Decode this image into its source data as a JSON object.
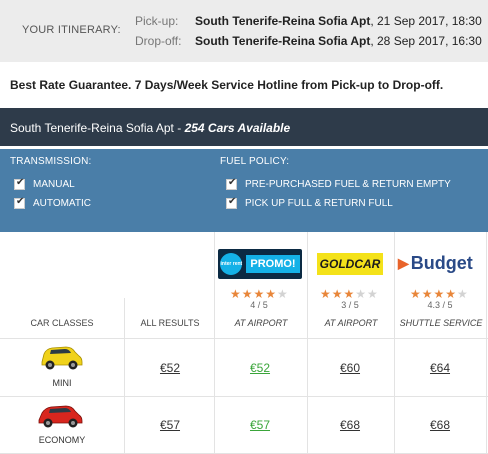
{
  "itinerary": {
    "label": "YOUR ITINERARY:",
    "pickup_key": "Pick-up:",
    "pickup_loc": "South Tenerife-Reina Sofia Apt",
    "pickup_date": ", 21 Sep 2017, 18:30",
    "dropoff_key": "Drop-off:",
    "dropoff_loc": "South Tenerife-Reina Sofia Apt",
    "dropoff_date": ", 28 Sep 2017, 16:30"
  },
  "guarantee": "Best Rate Guarantee. 7 Days/Week Service Hotline from Pick-up to Drop-off.",
  "results_bar": {
    "location": "South Tenerife-Reina Sofia Apt",
    "separator": " - ",
    "count": "254 Cars Available"
  },
  "filters": {
    "transmission_title": "TRANSMISSION:",
    "transmission_options": [
      "MANUAL",
      "AUTOMATIC"
    ],
    "fuel_title": "FUEL POLICY:",
    "fuel_options": [
      "PRE-PURCHASED FUEL & RETURN EMPTY",
      "PICK UP FULL & RETURN FULL"
    ]
  },
  "suppliers": [
    {
      "name": "interrent",
      "logo_text": "PROMO!",
      "logo_small": "inter rent",
      "stars": 4,
      "rating": "4 / 5",
      "location": "AT AIRPORT",
      "color": "#0b2a43"
    },
    {
      "name": "goldcar",
      "logo_text": "GOLDCAR",
      "stars": 3,
      "rating": "3 / 5",
      "location": "AT AIRPORT",
      "color": "#f4e21a"
    },
    {
      "name": "budget",
      "logo_text": "Budget",
      "stars": 4,
      "rating": "4.3 / 5",
      "location": "SHUTTLE SERVICE",
      "color": "#2a4a87"
    }
  ],
  "table": {
    "col_car_classes": "CAR CLASSES",
    "col_all_results": "ALL RESULTS",
    "rows": [
      {
        "class": "MINI",
        "car_color": "#f0d21a",
        "prices": [
          "€52",
          "€52",
          "€60",
          "€64"
        ]
      },
      {
        "class": "ECONOMY",
        "car_color": "#d8261e",
        "prices": [
          "€57",
          "€57",
          "€68",
          "€68"
        ]
      }
    ]
  },
  "colors": {
    "dark_bar": "#2e3b4a",
    "filter_bar": "#4a7ea8",
    "best_price": "#3aa53a",
    "star": "#e8863a"
  }
}
